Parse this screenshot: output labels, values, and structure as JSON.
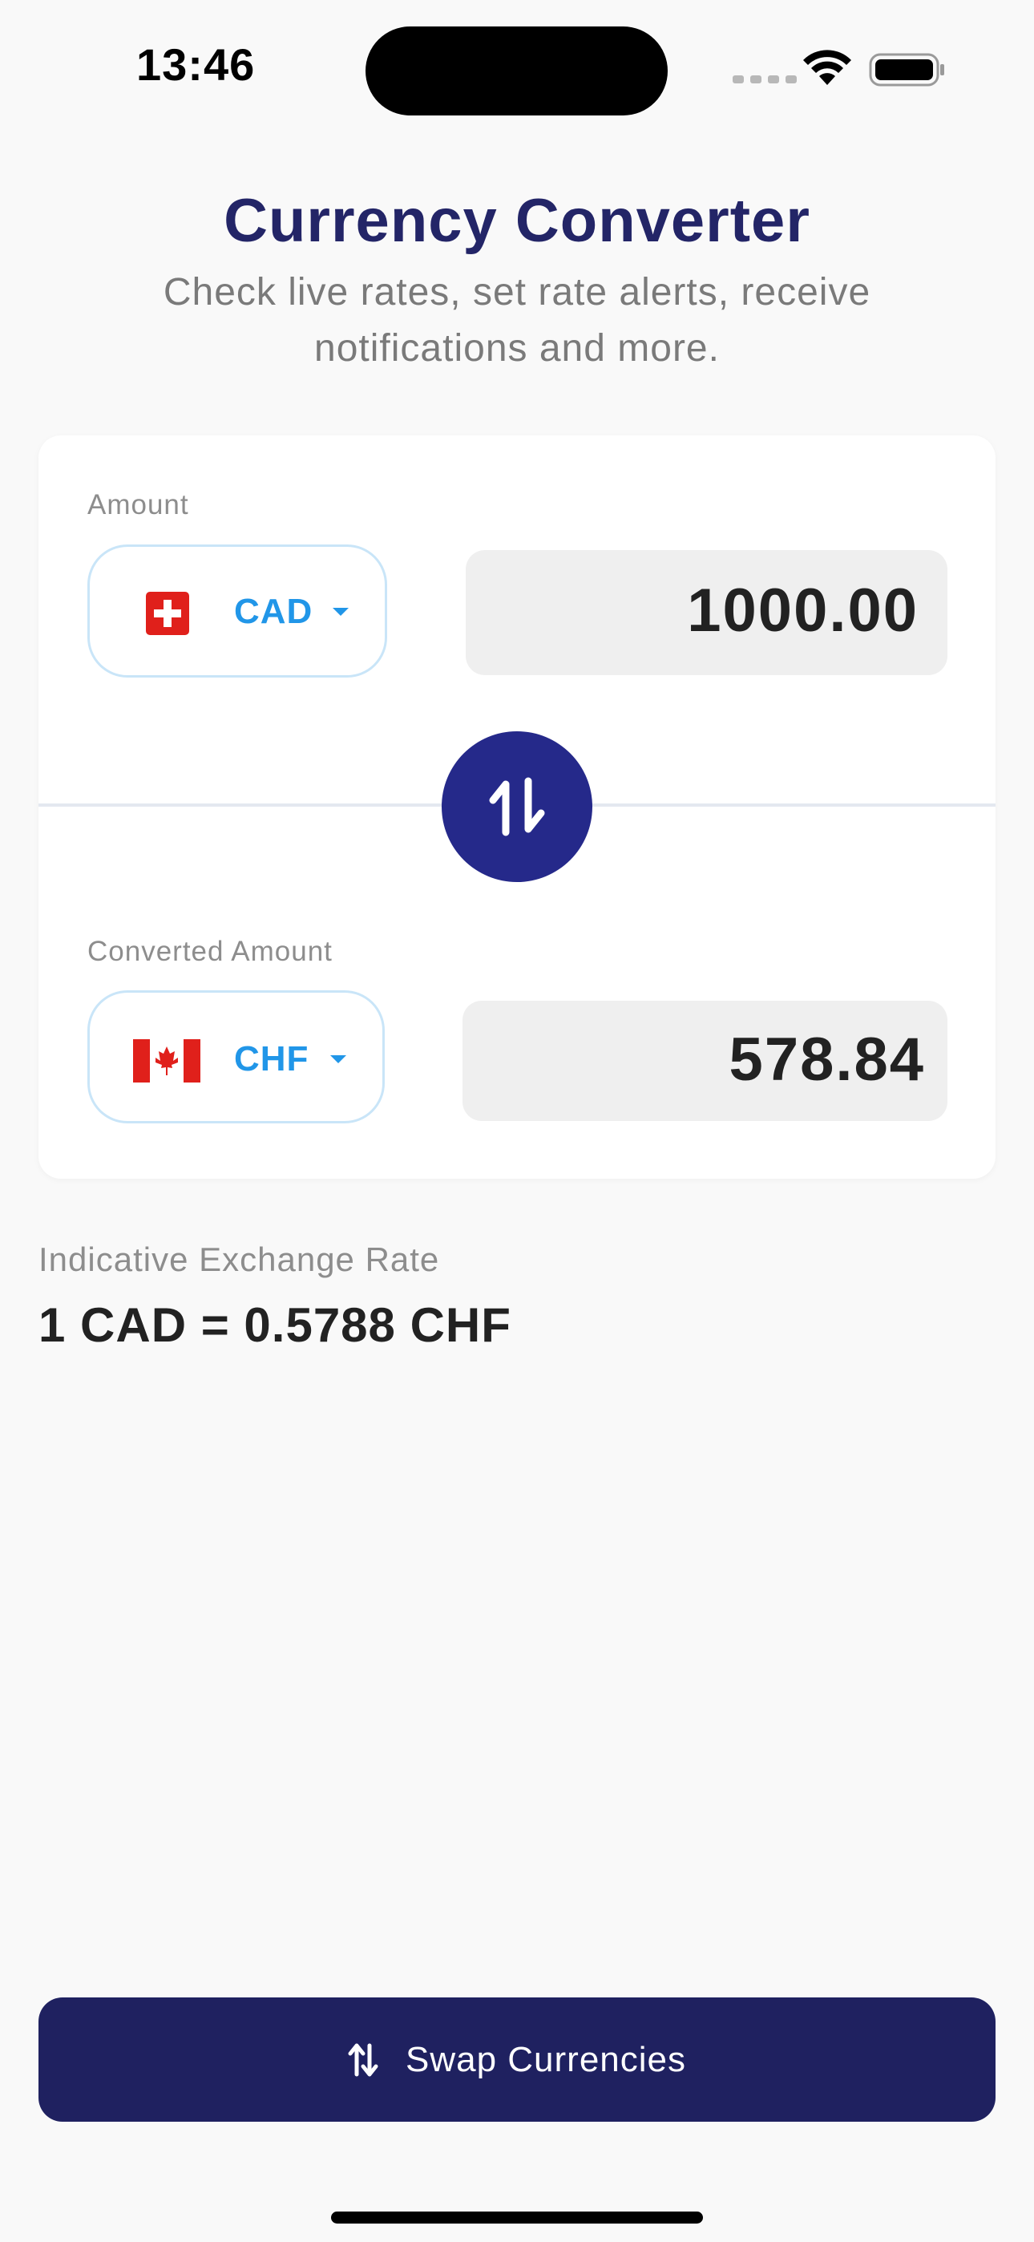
{
  "status_bar": {
    "time": "13:46",
    "icons": [
      "cellular-dots-icon",
      "wifi-icon",
      "battery-icon"
    ]
  },
  "header": {
    "title": "Currency Converter",
    "subtitle": "Check live rates, set rate alerts, receive notifications and more."
  },
  "converter": {
    "from": {
      "label": "Amount",
      "flag": "switzerland-flag-icon",
      "currency": "CAD",
      "amount": "1000.00"
    },
    "to": {
      "label": "Converted Amount",
      "flag": "canada-flag-icon",
      "currency": "CHF",
      "amount": "578.84"
    },
    "swap_icon": "swap-vertical-icon"
  },
  "rate": {
    "label": "Indicative Exchange Rate",
    "value": "1 CAD = 0.5788 CHF"
  },
  "bottom_button": {
    "icon": "swap-arrows-icon",
    "label": "Swap Currencies"
  },
  "colors": {
    "primary": "#232567",
    "accent": "#2196E8",
    "button": "#1F2160",
    "swap_circle": "#25298A",
    "background": "#F9F9F9"
  }
}
